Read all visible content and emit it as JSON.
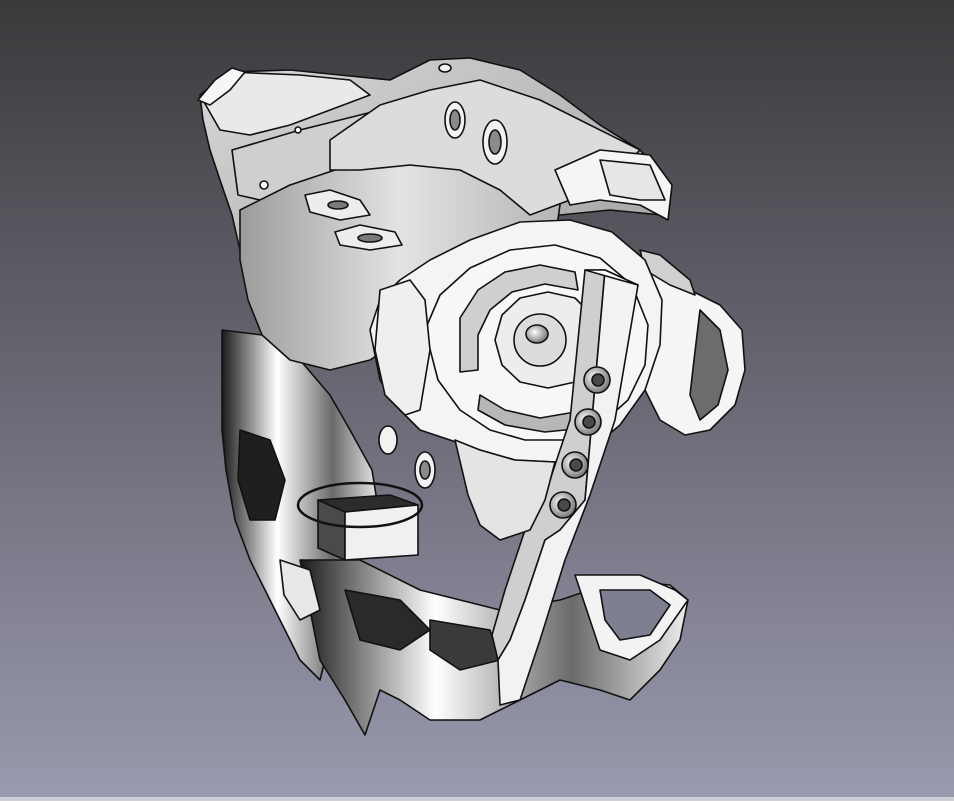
{
  "viewport": {
    "background_top": "#3a3a3c",
    "background_bottom": "#9a9ab0",
    "bottom_edge": "#cfcfd6"
  },
  "model": {
    "icon": "3d-mechanical-part",
    "face_light": "#f2f2f2",
    "face_mid": "#c9c9c9",
    "face_dark": "#5e5e5e",
    "edge_color": "#111111"
  }
}
